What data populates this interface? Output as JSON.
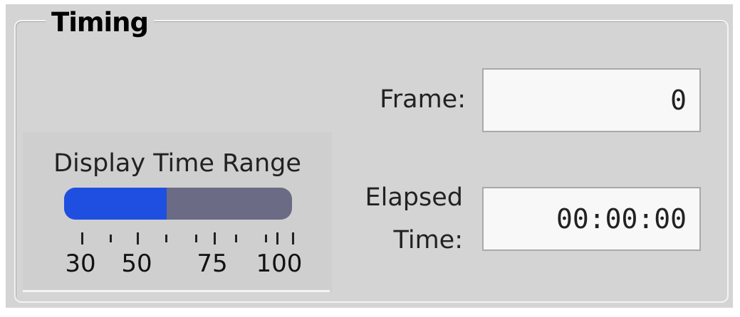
{
  "timing": {
    "title": "Timing",
    "display_time_range": {
      "label": "Display Time Range",
      "value_fraction": 0.45,
      "ticks": [
        "30",
        "50",
        "75",
        "100"
      ]
    },
    "frame": {
      "label": "Frame:",
      "value": "0"
    },
    "elapsed_time": {
      "label_line1": "Elapsed",
      "label_line2": "Time:",
      "value": "00:00:00"
    }
  },
  "colors": {
    "panel_bg": "#d4d4d4",
    "slider_fill": "#1f4fe0",
    "slider_track": "#6b6b86",
    "field_bg": "#f8f8f8"
  }
}
